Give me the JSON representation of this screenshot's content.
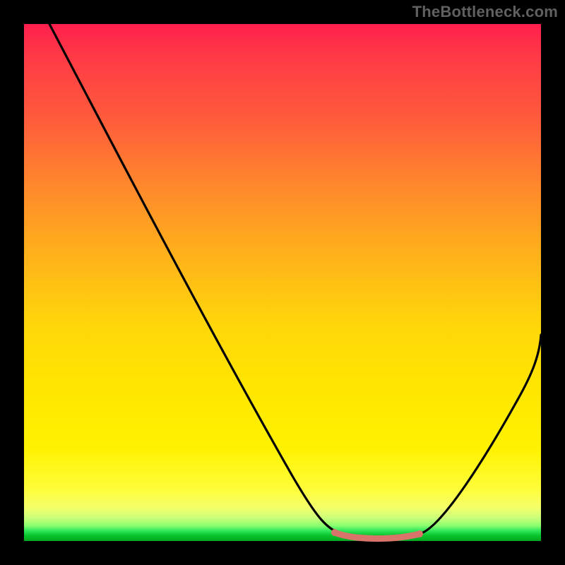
{
  "attribution": "TheBottleneck.com",
  "colors": {
    "page_bg": "#000000",
    "attribution_text": "#606060",
    "curve": "#000000",
    "highlight_segment": "#d9746a",
    "gradient_top": "#ff1f4e",
    "gradient_bottom": "#04a820"
  },
  "chart_data": {
    "type": "line",
    "title": "",
    "xlabel": "",
    "ylabel": "",
    "xlim": [
      0,
      100
    ],
    "ylim": [
      0,
      100
    ],
    "note": "Plot has no visible axes, ticks, or labels. Values below are estimated from pixel positions; x runs left→right 0–100, y is plotted-height (0 = bottom green band, 100 = top red). The visible black curve starts near the top-left, descends steeply to a flat minimum around x≈62–77, then rises toward the right edge (reaching roughly y≈40 at x=100). A short salmon-colored highlight sits on the flat minimum.",
    "series": [
      {
        "name": "curve",
        "color": "#000000",
        "x": [
          5,
          10,
          15,
          20,
          25,
          30,
          35,
          40,
          45,
          50,
          55,
          58,
          62,
          66,
          70,
          74,
          77,
          80,
          84,
          88,
          92,
          96,
          100
        ],
        "y": [
          100,
          92,
          83,
          74,
          65,
          56,
          47,
          39,
          30,
          22,
          14,
          8,
          3,
          1,
          0.5,
          0.5,
          1,
          4,
          10,
          17,
          24,
          32,
          40
        ]
      },
      {
        "name": "highlight-min",
        "color": "#d9746a",
        "x": [
          62,
          66,
          70,
          74,
          77
        ],
        "y": [
          3,
          1,
          0.5,
          0.5,
          1
        ]
      }
    ]
  }
}
